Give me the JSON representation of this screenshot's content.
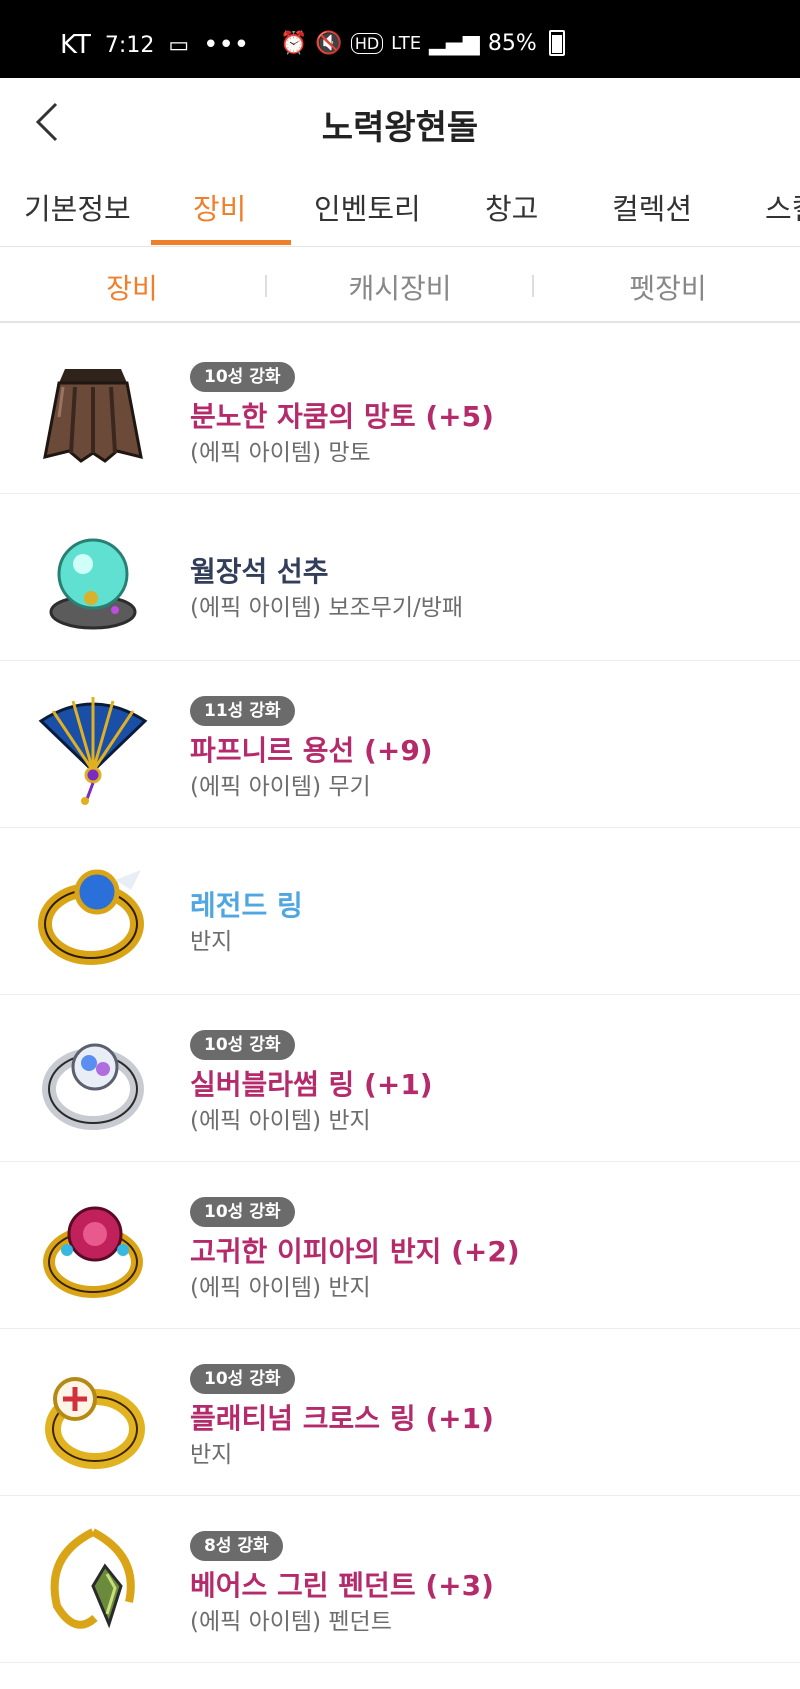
{
  "status_bar": {
    "carrier": "KT",
    "time": "7:12",
    "more": "•••",
    "network": "LTE",
    "battery_percent": "85%"
  },
  "header": {
    "title": "노력왕현돌",
    "back_icon": "chevron-left-icon"
  },
  "tabs": [
    {
      "label": "기본정보",
      "active": false
    },
    {
      "label": "장비",
      "active": true
    },
    {
      "label": "인벤토리",
      "active": false
    },
    {
      "label": "창고",
      "active": false
    },
    {
      "label": "컬렉션",
      "active": false
    },
    {
      "label": "스킬",
      "active": false
    }
  ],
  "subtabs": [
    {
      "label": "장비",
      "active": true
    },
    {
      "label": "캐시장비",
      "active": false
    },
    {
      "label": "펫장비",
      "active": false
    }
  ],
  "colors": {
    "accent": "#f07f2c",
    "epic": "#b42a6b",
    "normal": "#333f5a",
    "legend": "#4fa6e0",
    "badge_bg": "#6b6b6b"
  },
  "items": [
    {
      "badge": "10성 강화",
      "name": "분노한 자쿰의 망토 (+5)",
      "sub": "(에픽 아이템) 망토",
      "name_color": "#b42a6b",
      "icon": "cape-icon"
    },
    {
      "badge": "",
      "name": "월장석 선추",
      "sub": "(에픽 아이템) 보조무기/방패",
      "name_color": "#333f5a",
      "icon": "moonstone-tassel-icon"
    },
    {
      "badge": "11성 강화",
      "name": "파프니르 용선 (+9)",
      "sub": "(에픽 아이템) 무기",
      "name_color": "#b42a6b",
      "icon": "fan-icon"
    },
    {
      "badge": "",
      "name": "레전드 링",
      "sub": "반지",
      "name_color": "#4fa6e0",
      "icon": "legend-ring-icon"
    },
    {
      "badge": "10성 강화",
      "name": "실버블라썸 링 (+1)",
      "sub": "(에픽 아이템) 반지",
      "name_color": "#b42a6b",
      "icon": "silver-blossom-ring-icon"
    },
    {
      "badge": "10성 강화",
      "name": "고귀한 이피아의 반지 (+2)",
      "sub": "(에픽 아이템) 반지",
      "name_color": "#b42a6b",
      "icon": "rose-ring-icon"
    },
    {
      "badge": "10성 강화",
      "name": "플래티넘 크로스 링 (+1)",
      "sub": "반지",
      "name_color": "#b42a6b",
      "icon": "cross-ring-icon"
    },
    {
      "badge": "8성 강화",
      "name": "베어스 그린 펜던트 (+3)",
      "sub": "(에픽 아이템) 펜던트",
      "name_color": "#b42a6b",
      "icon": "pendant-icon"
    }
  ]
}
